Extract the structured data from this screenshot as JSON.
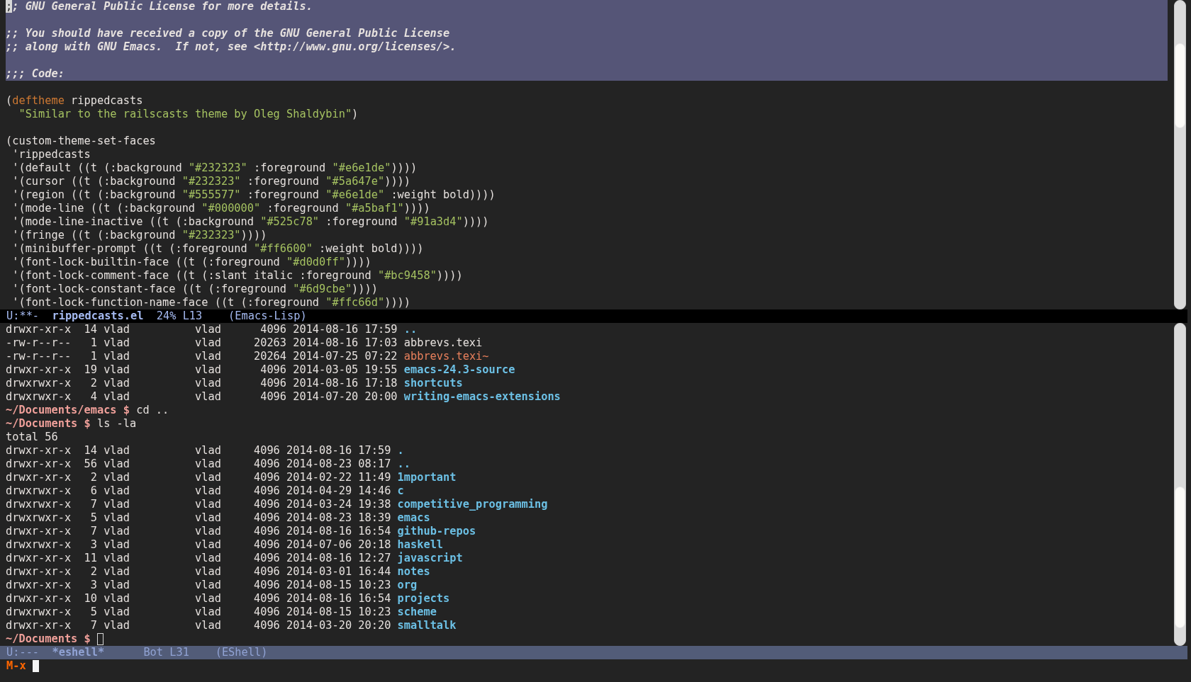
{
  "top_buffer": {
    "lines": [
      {
        "region": true,
        "segments": [
          {
            "kind": "cursor",
            "text": ";"
          },
          {
            "kind": "comment",
            "text": "; GNU General Public License for more details."
          }
        ]
      },
      {
        "region": true
      },
      {
        "region": true,
        "segments": [
          {
            "kind": "comment",
            "text": ";; You should have received a copy of the GNU General Public License"
          }
        ]
      },
      {
        "region": true,
        "segments": [
          {
            "kind": "comment",
            "text": ";; along with GNU Emacs.  If not, see <http://www.gnu.org/licenses/>."
          }
        ]
      },
      {
        "region": true
      },
      {
        "region": true,
        "segments": [
          {
            "kind": "comment",
            "text": ";;; Code:"
          }
        ]
      },
      {
        "region": false
      },
      {
        "region": false,
        "segments": [
          {
            "kind": "plain",
            "text": "("
          },
          {
            "kind": "keyword",
            "text": "deftheme"
          },
          {
            "kind": "plain",
            "text": " rippedcasts"
          }
        ]
      },
      {
        "region": false,
        "segments": [
          {
            "kind": "string",
            "text": "  \"Similar to the railscasts theme by Oleg Shaldybin\""
          },
          {
            "kind": "plain",
            "text": ")"
          }
        ]
      },
      {
        "region": false
      },
      {
        "region": false,
        "segments": [
          {
            "kind": "plain",
            "text": "(custom-theme-set-faces"
          }
        ]
      },
      {
        "region": false,
        "segments": [
          {
            "kind": "plain",
            "text": " 'rippedcasts"
          }
        ]
      },
      {
        "region": false,
        "segments": [
          {
            "kind": "plain",
            "text": " '(default ((t (:background "
          },
          {
            "kind": "string",
            "text": "\"#232323\""
          },
          {
            "kind": "plain",
            "text": " :foreground "
          },
          {
            "kind": "string",
            "text": "\"#e6e1de\""
          },
          {
            "kind": "plain",
            "text": "))))"
          }
        ]
      },
      {
        "region": false,
        "segments": [
          {
            "kind": "plain",
            "text": " '(cursor ((t (:background "
          },
          {
            "kind": "string",
            "text": "\"#232323\""
          },
          {
            "kind": "plain",
            "text": " :foreground "
          },
          {
            "kind": "string",
            "text": "\"#5a647e\""
          },
          {
            "kind": "plain",
            "text": "))))"
          }
        ]
      },
      {
        "region": false,
        "segments": [
          {
            "kind": "plain",
            "text": " '(region ((t (:background "
          },
          {
            "kind": "string",
            "text": "\"#555577\""
          },
          {
            "kind": "plain",
            "text": " :foreground "
          },
          {
            "kind": "string",
            "text": "\"#e6e1de\""
          },
          {
            "kind": "plain",
            "text": " :weight bold))))"
          }
        ]
      },
      {
        "region": false,
        "segments": [
          {
            "kind": "plain",
            "text": " '(mode-line ((t (:background "
          },
          {
            "kind": "string",
            "text": "\"#000000\""
          },
          {
            "kind": "plain",
            "text": " :foreground "
          },
          {
            "kind": "string",
            "text": "\"#a5baf1\""
          },
          {
            "kind": "plain",
            "text": "))))"
          }
        ]
      },
      {
        "region": false,
        "segments": [
          {
            "kind": "plain",
            "text": " '(mode-line-inactive ((t (:background "
          },
          {
            "kind": "string",
            "text": "\"#525c78\""
          },
          {
            "kind": "plain",
            "text": " :foreground "
          },
          {
            "kind": "string",
            "text": "\"#91a3d4\""
          },
          {
            "kind": "plain",
            "text": "))))"
          }
        ]
      },
      {
        "region": false,
        "segments": [
          {
            "kind": "plain",
            "text": " '(fringe ((t (:background "
          },
          {
            "kind": "string",
            "text": "\"#232323\""
          },
          {
            "kind": "plain",
            "text": "))))"
          }
        ]
      },
      {
        "region": false,
        "segments": [
          {
            "kind": "plain",
            "text": " '(minibuffer-prompt ((t (:foreground "
          },
          {
            "kind": "string",
            "text": "\"#ff6600\""
          },
          {
            "kind": "plain",
            "text": " :weight bold))))"
          }
        ]
      },
      {
        "region": false,
        "segments": [
          {
            "kind": "plain",
            "text": " '(font-lock-builtin-face ((t (:foreground "
          },
          {
            "kind": "string",
            "text": "\"#d0d0ff\""
          },
          {
            "kind": "plain",
            "text": "))))"
          }
        ]
      },
      {
        "region": false,
        "segments": [
          {
            "kind": "plain",
            "text": " '(font-lock-comment-face ((t (:slant italic :foreground "
          },
          {
            "kind": "string",
            "text": "\"#bc9458\""
          },
          {
            "kind": "plain",
            "text": "))))"
          }
        ]
      },
      {
        "region": false,
        "segments": [
          {
            "kind": "plain",
            "text": " '(font-lock-constant-face ((t (:foreground "
          },
          {
            "kind": "string",
            "text": "\"#6d9cbe\""
          },
          {
            "kind": "plain",
            "text": "))))"
          }
        ]
      },
      {
        "region": false,
        "segments": [
          {
            "kind": "plain",
            "text": " '(font-lock-function-name-face ((t (:foreground "
          },
          {
            "kind": "string",
            "text": "\"#ffc66d\""
          },
          {
            "kind": "plain",
            "text": "))))"
          }
        ]
      }
    ]
  },
  "top_mode_line": {
    "active": true,
    "fields": [
      {
        "kind": "flags",
        "text": "U:**-"
      },
      {
        "kind": "buffer",
        "text": "rippedcasts.el"
      },
      {
        "kind": "position",
        "text": "24% L13"
      },
      {
        "kind": "mode",
        "text": "(Emacs-Lisp)"
      }
    ]
  },
  "bottom_buffer": {
    "lines": [
      {
        "segments": [
          {
            "kind": "plain",
            "text": "drwxr-xr-x  14 vlad          vlad      4096 2014-08-16 17:59 "
          },
          {
            "kind": "dir",
            "text": ".."
          }
        ]
      },
      {
        "segments": [
          {
            "kind": "plain",
            "text": "-rw-r--r--   1 vlad          vlad     20263 2014-08-16 17:03 abbrevs.texi"
          }
        ]
      },
      {
        "segments": [
          {
            "kind": "plain",
            "text": "-rw-r--r--   1 vlad          vlad     20264 2014-07-25 07:22 "
          },
          {
            "kind": "backup",
            "text": "abbrevs.texi~"
          }
        ]
      },
      {
        "segments": [
          {
            "kind": "plain",
            "text": "drwxr-xr-x  19 vlad          vlad      4096 2014-03-05 19:55 "
          },
          {
            "kind": "dir",
            "text": "emacs-24.3-source"
          }
        ]
      },
      {
        "segments": [
          {
            "kind": "plain",
            "text": "drwxrwxr-x   2 vlad          vlad      4096 2014-08-16 17:18 "
          },
          {
            "kind": "dir",
            "text": "shortcuts"
          }
        ]
      },
      {
        "segments": [
          {
            "kind": "plain",
            "text": "drwxrwxr-x   4 vlad          vlad      4096 2014-07-20 20:00 "
          },
          {
            "kind": "dir",
            "text": "writing-emacs-extensions"
          }
        ]
      },
      {
        "segments": [
          {
            "kind": "prompt",
            "text": "~/Documents/emacs $"
          },
          {
            "kind": "plain",
            "text": " cd .."
          }
        ]
      },
      {
        "segments": [
          {
            "kind": "prompt",
            "text": "~/Documents $"
          },
          {
            "kind": "plain",
            "text": " ls -la"
          }
        ]
      },
      {
        "segments": [
          {
            "kind": "plain",
            "text": "total 56"
          }
        ]
      },
      {
        "segments": [
          {
            "kind": "plain",
            "text": "drwxr-xr-x  14 vlad          vlad     4096 2014-08-16 17:59 "
          },
          {
            "kind": "dir",
            "text": "."
          }
        ]
      },
      {
        "segments": [
          {
            "kind": "plain",
            "text": "drwxr-xr-x  56 vlad          vlad     4096 2014-08-23 08:17 "
          },
          {
            "kind": "dir",
            "text": ".."
          }
        ]
      },
      {
        "segments": [
          {
            "kind": "plain",
            "text": "drwxr-xr-x   2 vlad          vlad     4096 2014-02-22 11:49 "
          },
          {
            "kind": "dir",
            "text": "1mportant"
          }
        ]
      },
      {
        "segments": [
          {
            "kind": "plain",
            "text": "drwxrwxr-x   6 vlad          vlad     4096 2014-04-29 14:46 "
          },
          {
            "kind": "dir",
            "text": "c"
          }
        ]
      },
      {
        "segments": [
          {
            "kind": "plain",
            "text": "drwxrwxr-x   7 vlad          vlad     4096 2014-03-24 19:38 "
          },
          {
            "kind": "dir",
            "text": "competitive_programming"
          }
        ]
      },
      {
        "segments": [
          {
            "kind": "plain",
            "text": "drwxrwxr-x   5 vlad          vlad     4096 2014-08-23 18:39 "
          },
          {
            "kind": "dir",
            "text": "emacs"
          }
        ]
      },
      {
        "segments": [
          {
            "kind": "plain",
            "text": "drwxr-xr-x   7 vlad          vlad     4096 2014-08-16 16:54 "
          },
          {
            "kind": "dir",
            "text": "github-repos"
          }
        ]
      },
      {
        "segments": [
          {
            "kind": "plain",
            "text": "drwxrwxr-x   3 vlad          vlad     4096 2014-07-06 20:18 "
          },
          {
            "kind": "dir",
            "text": "haskell"
          }
        ]
      },
      {
        "segments": [
          {
            "kind": "plain",
            "text": "drwxr-xr-x  11 vlad          vlad     4096 2014-08-16 12:27 "
          },
          {
            "kind": "dir",
            "text": "javascript"
          }
        ]
      },
      {
        "segments": [
          {
            "kind": "plain",
            "text": "drwxr-xr-x   2 vlad          vlad     4096 2014-03-01 16:44 "
          },
          {
            "kind": "dir",
            "text": "notes"
          }
        ]
      },
      {
        "segments": [
          {
            "kind": "plain",
            "text": "drwxr-xr-x   3 vlad          vlad     4096 2014-08-15 10:23 "
          },
          {
            "kind": "dir",
            "text": "org"
          }
        ]
      },
      {
        "segments": [
          {
            "kind": "plain",
            "text": "drwxr-xr-x  10 vlad          vlad     4096 2014-08-16 16:54 "
          },
          {
            "kind": "dir",
            "text": "projects"
          }
        ]
      },
      {
        "segments": [
          {
            "kind": "plain",
            "text": "drwxrwxr-x   5 vlad          vlad     4096 2014-08-15 10:23 "
          },
          {
            "kind": "dir",
            "text": "scheme"
          }
        ]
      },
      {
        "segments": [
          {
            "kind": "plain",
            "text": "drwxr-xr-x   7 vlad          vlad     4096 2014-03-20 20:20 "
          },
          {
            "kind": "dir",
            "text": "smalltalk"
          }
        ]
      },
      {
        "segments": [
          {
            "kind": "prompt",
            "text": "~/Documents $"
          }
        ],
        "cursor": true
      }
    ]
  },
  "bottom_mode_line": {
    "active": false,
    "fields": [
      {
        "kind": "flags",
        "text": "U:---"
      },
      {
        "kind": "buffer",
        "text": "*eshell*"
      },
      {
        "kind": "position",
        "text": "Bot L31"
      },
      {
        "kind": "mode",
        "text": "(EShell)"
      }
    ]
  },
  "minibuffer": {
    "prompt": "M-x",
    "cursor": true
  }
}
